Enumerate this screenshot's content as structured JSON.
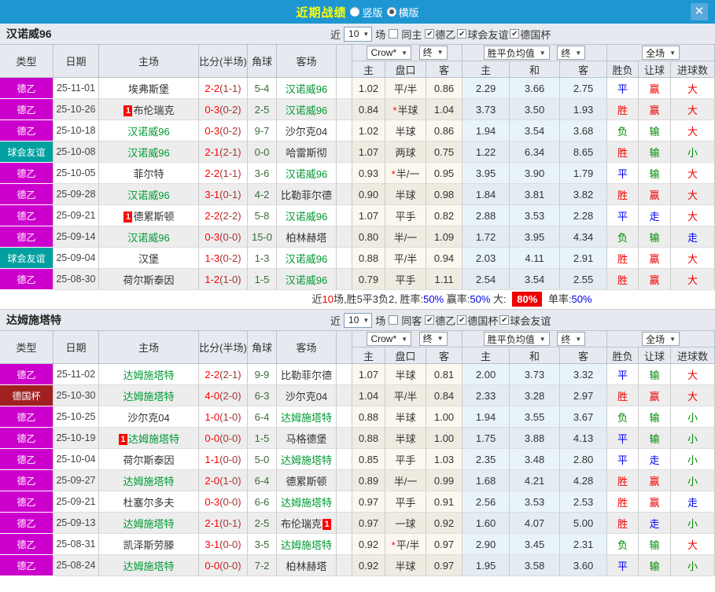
{
  "titlebar": {
    "title": "近期战绩",
    "radios": [
      {
        "label": "竖版",
        "selected": false
      },
      {
        "label": "横版",
        "selected": true
      }
    ],
    "close_label": "✕"
  },
  "colors": {
    "titlebar_bg": "#1e96d2",
    "title_text": "#ffff00",
    "league_badge": "#cc00cc",
    "friendly_badge": "#00a0a0",
    "cup_badge": "#a12121",
    "subject_team": "#009933",
    "score": "#ff0000",
    "win": "#f00000",
    "draw": "#0000ee",
    "loss": "#008800"
  },
  "table_header": {
    "col_type": "类型",
    "col_date": "日期",
    "col_home": "主场",
    "col_score": "比分(半场)",
    "col_corner": "角球",
    "col_away": "客场",
    "odds_source": "Crow*",
    "final_label": "终",
    "avg_label": "胜平负均值",
    "final2_label": "终",
    "fulltime_label": "全场",
    "sub_home": "主",
    "sub_handicap": "盘口",
    "sub_away": "客",
    "sub_avg_home": "主",
    "sub_avg_draw": "和",
    "sub_avg_away": "客",
    "sub_wdl": "胜负",
    "sub_let": "让球",
    "sub_goals": "进球数"
  },
  "sections": [
    {
      "team": "汉诺威96",
      "filter": {
        "near_label": "近",
        "count": "10",
        "unit_label": "场",
        "same_label": "同主",
        "comps": [
          "德乙",
          "球会友谊",
          "德国杯"
        ]
      },
      "rows": [
        {
          "comp": "德乙",
          "key": "league",
          "date": "25-11-01",
          "home": "埃弗斯堡",
          "hg": false,
          "hb": false,
          "score": "2-2",
          "half": "(1-1)",
          "corner": "5-4",
          "away": "汉诺威96",
          "ag": true,
          "ab": false,
          "o1": "1.02",
          "hcap": "平/半",
          "star": false,
          "o2": "0.86",
          "m1": "2.29",
          "m2": "3.66",
          "m3": "2.75",
          "r1": [
            "平",
            "blue"
          ],
          "r2": [
            "赢",
            "red"
          ],
          "r3": [
            "大",
            "red"
          ]
        },
        {
          "comp": "德乙",
          "key": "league",
          "date": "25-10-26",
          "home": "布伦瑞克",
          "hg": false,
          "hb": true,
          "score": "0-3",
          "half": "(0-2)",
          "corner": "2-5",
          "away": "汉诺威96",
          "ag": true,
          "ab": false,
          "o1": "0.84",
          "hcap": "半球",
          "star": true,
          "o2": "1.04",
          "m1": "3.73",
          "m2": "3.50",
          "m3": "1.93",
          "r1": [
            "胜",
            "red"
          ],
          "r2": [
            "赢",
            "red"
          ],
          "r3": [
            "大",
            "red"
          ]
        },
        {
          "comp": "德乙",
          "key": "league",
          "date": "25-10-18",
          "home": "汉诺威96",
          "hg": true,
          "hb": false,
          "score": "0-3",
          "half": "(0-2)",
          "corner": "9-7",
          "away": "沙尔克04",
          "ag": false,
          "ab": false,
          "o1": "1.02",
          "hcap": "半球",
          "star": false,
          "o2": "0.86",
          "m1": "1.94",
          "m2": "3.54",
          "m3": "3.68",
          "r1": [
            "负",
            "green"
          ],
          "r2": [
            "输",
            "green"
          ],
          "r3": [
            "大",
            "red"
          ]
        },
        {
          "comp": "球会友谊",
          "key": "friendly",
          "date": "25-10-08",
          "home": "汉诺威96",
          "hg": true,
          "hb": false,
          "score": "2-1",
          "half": "(2-1)",
          "corner": "0-0",
          "away": "哈雷斯彻",
          "ag": false,
          "ab": false,
          "o1": "1.07",
          "hcap": "两球",
          "star": false,
          "o2": "0.75",
          "m1": "1.22",
          "m2": "6.34",
          "m3": "8.65",
          "r1": [
            "胜",
            "red"
          ],
          "r2": [
            "输",
            "green"
          ],
          "r3": [
            "小",
            "green"
          ]
        },
        {
          "comp": "德乙",
          "key": "league",
          "date": "25-10-05",
          "home": "菲尔特",
          "hg": false,
          "hb": false,
          "score": "2-2",
          "half": "(1-1)",
          "corner": "3-6",
          "away": "汉诺威96",
          "ag": true,
          "ab": false,
          "o1": "0.93",
          "hcap": "半/一",
          "star": true,
          "o2": "0.95",
          "m1": "3.95",
          "m2": "3.90",
          "m3": "1.79",
          "r1": [
            "平",
            "blue"
          ],
          "r2": [
            "输",
            "green"
          ],
          "r3": [
            "大",
            "red"
          ]
        },
        {
          "comp": "德乙",
          "key": "league",
          "date": "25-09-28",
          "home": "汉诺威96",
          "hg": true,
          "hb": false,
          "score": "3-1",
          "half": "(0-1)",
          "corner": "4-2",
          "away": "比勒菲尔德",
          "ag": false,
          "ab": false,
          "o1": "0.90",
          "hcap": "半球",
          "star": false,
          "o2": "0.98",
          "m1": "1.84",
          "m2": "3.81",
          "m3": "3.82",
          "r1": [
            "胜",
            "red"
          ],
          "r2": [
            "赢",
            "red"
          ],
          "r3": [
            "大",
            "red"
          ]
        },
        {
          "comp": "德乙",
          "key": "league",
          "date": "25-09-21",
          "home": "德累斯顿",
          "hg": false,
          "hb": true,
          "score": "2-2",
          "half": "(2-2)",
          "corner": "5-8",
          "away": "汉诺威96",
          "ag": true,
          "ab": false,
          "o1": "1.07",
          "hcap": "平手",
          "star": false,
          "o2": "0.82",
          "m1": "2.88",
          "m2": "3.53",
          "m3": "2.28",
          "r1": [
            "平",
            "blue"
          ],
          "r2": [
            "走",
            "blue"
          ],
          "r3": [
            "大",
            "red"
          ]
        },
        {
          "comp": "德乙",
          "key": "league",
          "date": "25-09-14",
          "home": "汉诺威96",
          "hg": true,
          "hb": false,
          "score": "0-3",
          "half": "(0-0)",
          "corner": "15-0",
          "away": "柏林赫塔",
          "ag": false,
          "ab": false,
          "o1": "0.80",
          "hcap": "半/一",
          "star": false,
          "o2": "1.09",
          "m1": "1.72",
          "m2": "3.95",
          "m3": "4.34",
          "r1": [
            "负",
            "green"
          ],
          "r2": [
            "输",
            "green"
          ],
          "r3": [
            "走",
            "blue"
          ]
        },
        {
          "comp": "球会友谊",
          "key": "friendly",
          "date": "25-09-04",
          "home": "汉堡",
          "hg": false,
          "hb": false,
          "score": "1-3",
          "half": "(0-2)",
          "corner": "1-3",
          "away": "汉诺威96",
          "ag": true,
          "ab": false,
          "o1": "0.88",
          "hcap": "平/半",
          "star": false,
          "o2": "0.94",
          "m1": "2.03",
          "m2": "4.11",
          "m3": "2.91",
          "r1": [
            "胜",
            "red"
          ],
          "r2": [
            "赢",
            "red"
          ],
          "r3": [
            "大",
            "red"
          ]
        },
        {
          "comp": "德乙",
          "key": "league",
          "date": "25-08-30",
          "home": "荷尔斯泰因",
          "hg": false,
          "hb": false,
          "score": "1-2",
          "half": "(1-0)",
          "corner": "1-5",
          "away": "汉诺威96",
          "ag": true,
          "ab": false,
          "o1": "0.79",
          "hcap": "平手",
          "star": false,
          "o2": "1.11",
          "m1": "2.54",
          "m2": "3.54",
          "m3": "2.55",
          "r1": [
            "胜",
            "red"
          ],
          "r2": [
            "赢",
            "red"
          ],
          "r3": [
            "大",
            "red"
          ]
        }
      ],
      "summary": [
        {
          "text": "近"
        },
        {
          "text": "10",
          "style": "red"
        },
        {
          "text": "场,胜5平3负2, 胜率:"
        },
        {
          "text": "50%",
          "style": "blue"
        },
        {
          "text": " 赢率:"
        },
        {
          "text": "50%",
          "style": "blue"
        },
        {
          "text": " 大: "
        },
        {
          "text": "80%",
          "style": "badge"
        },
        {
          "text": " 单率:"
        },
        {
          "text": "50%",
          "style": "blue"
        }
      ]
    },
    {
      "team": "达姆施塔特",
      "filter": {
        "near_label": "近",
        "count": "10",
        "unit_label": "场",
        "same_label": "同客",
        "comps": [
          "德乙",
          "德国杯",
          "球会友谊"
        ]
      },
      "rows": [
        {
          "comp": "德乙",
          "key": "league",
          "date": "25-11-02",
          "home": "达姆施塔特",
          "hg": true,
          "hb": false,
          "score": "2-2",
          "half": "(2-1)",
          "corner": "9-9",
          "away": "比勒菲尔德",
          "ag": false,
          "ab": false,
          "o1": "1.07",
          "hcap": "半球",
          "star": false,
          "o2": "0.81",
          "m1": "2.00",
          "m2": "3.73",
          "m3": "3.32",
          "r1": [
            "平",
            "blue"
          ],
          "r2": [
            "输",
            "green"
          ],
          "r3": [
            "大",
            "red"
          ]
        },
        {
          "comp": "德国杯",
          "key": "cup",
          "date": "25-10-30",
          "home": "达姆施塔特",
          "hg": true,
          "hb": false,
          "score": "4-0",
          "half": "(2-0)",
          "corner": "6-3",
          "away": "沙尔克04",
          "ag": false,
          "ab": false,
          "o1": "1.04",
          "hcap": "平/半",
          "star": false,
          "o2": "0.84",
          "m1": "2.33",
          "m2": "3.28",
          "m3": "2.97",
          "r1": [
            "胜",
            "red"
          ],
          "r2": [
            "赢",
            "red"
          ],
          "r3": [
            "大",
            "red"
          ]
        },
        {
          "comp": "德乙",
          "key": "league",
          "date": "25-10-25",
          "home": "沙尔克04",
          "hg": false,
          "hb": false,
          "score": "1-0",
          "half": "(1-0)",
          "corner": "6-4",
          "away": "达姆施塔特",
          "ag": true,
          "ab": false,
          "o1": "0.88",
          "hcap": "半球",
          "star": false,
          "o2": "1.00",
          "m1": "1.94",
          "m2": "3.55",
          "m3": "3.67",
          "r1": [
            "负",
            "green"
          ],
          "r2": [
            "输",
            "green"
          ],
          "r3": [
            "小",
            "green"
          ]
        },
        {
          "comp": "德乙",
          "key": "league",
          "date": "25-10-19",
          "home": "达姆施塔特",
          "hg": true,
          "hb": true,
          "score": "0-0",
          "half": "(0-0)",
          "corner": "1-5",
          "away": "马格德堡",
          "ag": false,
          "ab": false,
          "o1": "0.88",
          "hcap": "半球",
          "star": false,
          "o2": "1.00",
          "m1": "1.75",
          "m2": "3.88",
          "m3": "4.13",
          "r1": [
            "平",
            "blue"
          ],
          "r2": [
            "输",
            "green"
          ],
          "r3": [
            "小",
            "green"
          ]
        },
        {
          "comp": "德乙",
          "key": "league",
          "date": "25-10-04",
          "home": "荷尔斯泰因",
          "hg": false,
          "hb": false,
          "score": "1-1",
          "half": "(0-0)",
          "corner": "5-0",
          "away": "达姆施塔特",
          "ag": true,
          "ab": false,
          "o1": "0.85",
          "hcap": "平手",
          "star": false,
          "o2": "1.03",
          "m1": "2.35",
          "m2": "3.48",
          "m3": "2.80",
          "r1": [
            "平",
            "blue"
          ],
          "r2": [
            "走",
            "blue"
          ],
          "r3": [
            "小",
            "green"
          ]
        },
        {
          "comp": "德乙",
          "key": "league",
          "date": "25-09-27",
          "home": "达姆施塔特",
          "hg": true,
          "hb": false,
          "score": "2-0",
          "half": "(1-0)",
          "corner": "6-4",
          "away": "德累斯顿",
          "ag": false,
          "ab": false,
          "o1": "0.89",
          "hcap": "半/一",
          "star": false,
          "o2": "0.99",
          "m1": "1.68",
          "m2": "4.21",
          "m3": "4.28",
          "r1": [
            "胜",
            "red"
          ],
          "r2": [
            "赢",
            "red"
          ],
          "r3": [
            "小",
            "green"
          ]
        },
        {
          "comp": "德乙",
          "key": "league",
          "date": "25-09-21",
          "home": "杜塞尔多夫",
          "hg": false,
          "hb": false,
          "score": "0-3",
          "half": "(0-0)",
          "corner": "6-6",
          "away": "达姆施塔特",
          "ag": true,
          "ab": false,
          "o1": "0.97",
          "hcap": "平手",
          "star": false,
          "o2": "0.91",
          "m1": "2.56",
          "m2": "3.53",
          "m3": "2.53",
          "r1": [
            "胜",
            "red"
          ],
          "r2": [
            "赢",
            "red"
          ],
          "r3": [
            "走",
            "blue"
          ]
        },
        {
          "comp": "德乙",
          "key": "league",
          "date": "25-09-13",
          "home": "达姆施塔特",
          "hg": true,
          "hb": false,
          "score": "2-1",
          "half": "(0-1)",
          "corner": "2-5",
          "away": "布伦瑞克",
          "ag": false,
          "ab": true,
          "o1": "0.97",
          "hcap": "一球",
          "star": false,
          "o2": "0.92",
          "m1": "1.60",
          "m2": "4.07",
          "m3": "5.00",
          "r1": [
            "胜",
            "red"
          ],
          "r2": [
            "走",
            "blue"
          ],
          "r3": [
            "小",
            "green"
          ]
        },
        {
          "comp": "德乙",
          "key": "league",
          "date": "25-08-31",
          "home": "凯泽斯劳滕",
          "hg": false,
          "hb": false,
          "score": "3-1",
          "half": "(0-0)",
          "corner": "3-5",
          "away": "达姆施塔特",
          "ag": true,
          "ab": false,
          "o1": "0.92",
          "hcap": "平/半",
          "star": true,
          "o2": "0.97",
          "m1": "2.90",
          "m2": "3.45",
          "m3": "2.31",
          "r1": [
            "负",
            "green"
          ],
          "r2": [
            "输",
            "green"
          ],
          "r3": [
            "大",
            "red"
          ]
        },
        {
          "comp": "德乙",
          "key": "league",
          "date": "25-08-24",
          "home": "达姆施塔特",
          "hg": true,
          "hb": false,
          "score": "0-0",
          "half": "(0-0)",
          "corner": "7-2",
          "away": "柏林赫塔",
          "ag": false,
          "ab": false,
          "o1": "0.92",
          "hcap": "半球",
          "star": false,
          "o2": "0.97",
          "m1": "1.95",
          "m2": "3.58",
          "m3": "3.60",
          "r1": [
            "平",
            "blue"
          ],
          "r2": [
            "输",
            "green"
          ],
          "r3": [
            "小",
            "green"
          ]
        }
      ]
    }
  ]
}
